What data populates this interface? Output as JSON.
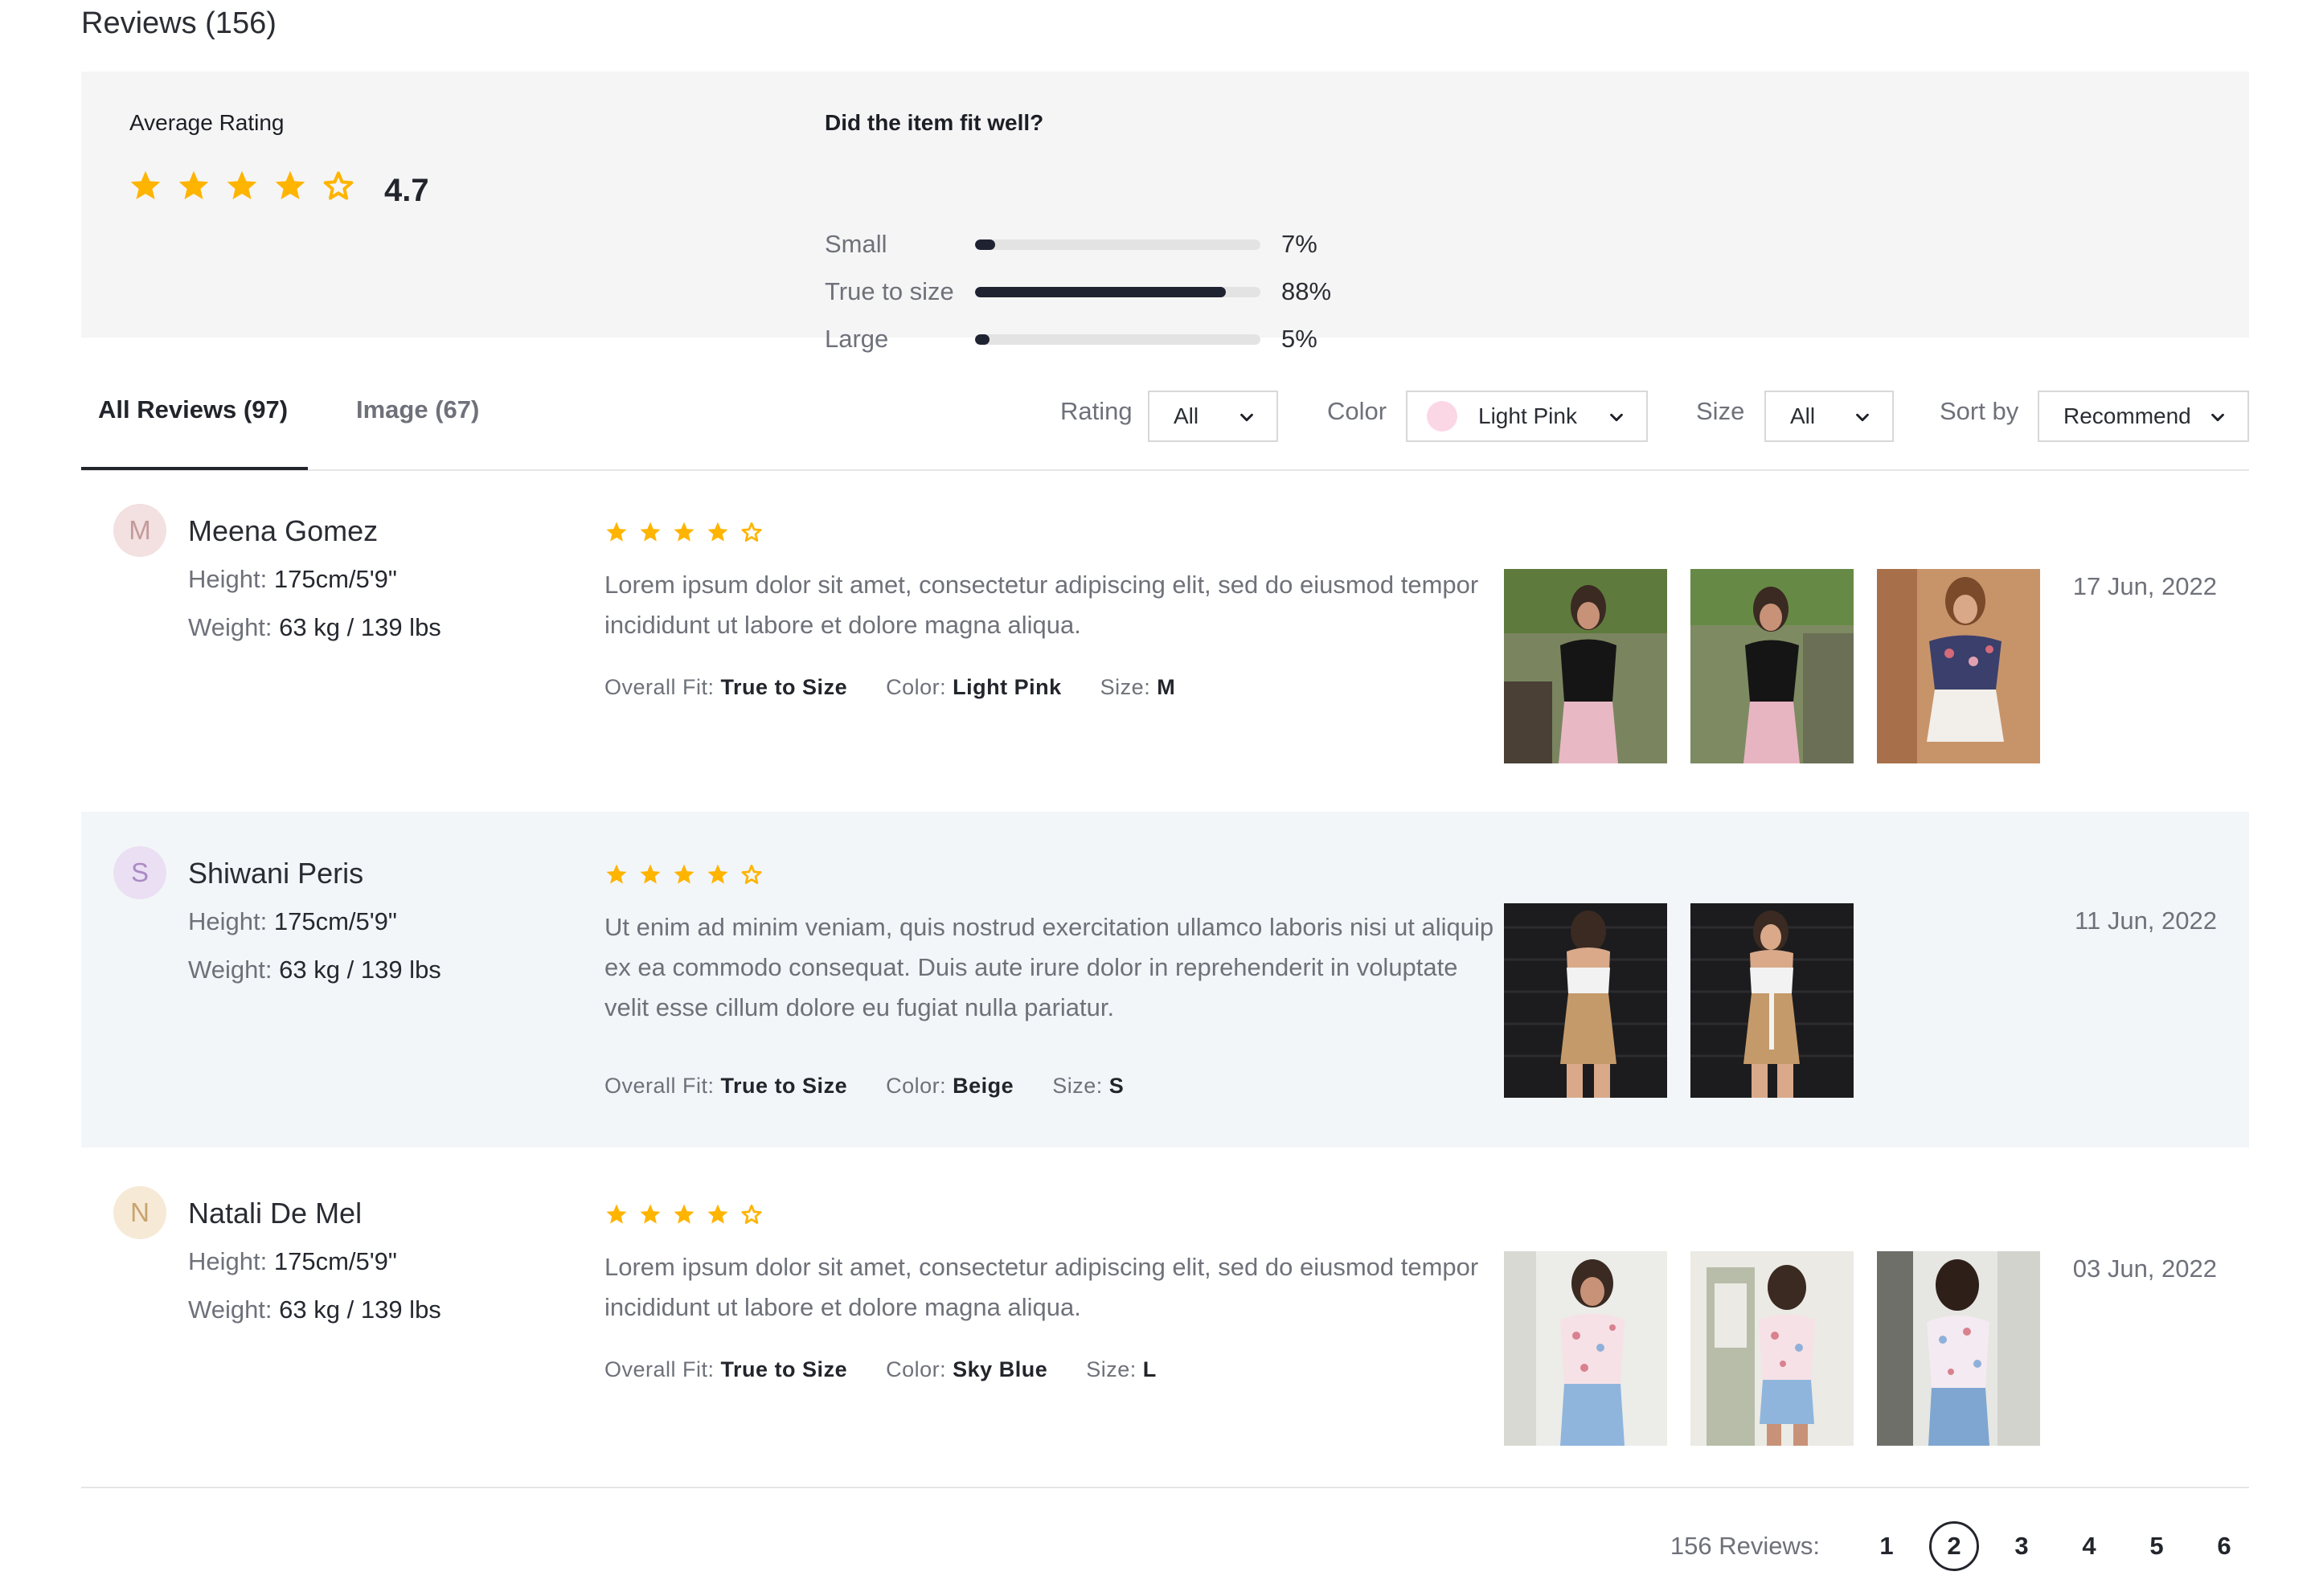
{
  "header": {
    "title": "Reviews (156)"
  },
  "summary": {
    "average_label": "Average Rating",
    "average_value": "4.7",
    "average_stars": 4,
    "fit_title": "Did the item fit well?",
    "fit": [
      {
        "label": "Small",
        "percent": 7,
        "percent_text": "7%"
      },
      {
        "label": "True to size",
        "percent": 88,
        "percent_text": "88%"
      },
      {
        "label": "Large",
        "percent": 5,
        "percent_text": "5%"
      }
    ]
  },
  "tabs": [
    {
      "label": "All Reviews (97)",
      "active": true
    },
    {
      "label": "Image (67)",
      "active": false
    }
  ],
  "filters": {
    "rating_label": "Rating",
    "rating_value": "All",
    "color_label": "Color",
    "color_value": "Light Pink",
    "color_swatch": "#fbd7e6",
    "size_label": "Size",
    "size_value": "All",
    "sort_label": "Sort by",
    "sort_value": "Recommend"
  },
  "labels": {
    "height": "Height:",
    "weight": "Weight:",
    "overall_fit": "Overall Fit:",
    "color": "Color:",
    "size": "Size:"
  },
  "reviews": [
    {
      "initial": "M",
      "avatar_bg": "#f3e0e0",
      "avatar_fg": "#c49a9a",
      "name": "Meena Gomez",
      "height": "175cm/5'9\"",
      "weight": "63 kg / 139 lbs",
      "stars": 4,
      "text": "Lorem ipsum dolor sit amet, consectetur adipiscing elit, sed do eiusmod tempor incididunt ut labore et dolore magna aliqua.",
      "fit": "True to Size",
      "color": "Light Pink",
      "size": "M",
      "date": "17 Jun, 2022",
      "photos": [
        "photo-black-top-pink-shorts",
        "photo-black-top-pink-shorts-side",
        "photo-floral-top-white-shorts"
      ]
    },
    {
      "initial": "S",
      "avatar_bg": "#eadff3",
      "avatar_fg": "#ab8ac4",
      "name": "Shiwani Peris",
      "height": "175cm/5'9\"",
      "weight": "63 kg / 139 lbs",
      "stars": 4,
      "text": "Ut enim ad minim veniam, quis nostrud exercitation ullamco laboris nisi ut aliquip ex ea commodo consequat. Duis aute irure dolor in reprehenderit in voluptate velit esse cillum dolore eu fugiat nulla pariatur.",
      "fit": "True to Size",
      "color": "Beige",
      "size": "S",
      "date": "11 Jun, 2022",
      "photos": [
        "photo-beige-shorts-back",
        "photo-beige-shorts-front"
      ]
    },
    {
      "initial": "N",
      "avatar_bg": "#f6e9d6",
      "avatar_fg": "#c9a46e",
      "name": "Natali De Mel",
      "height": "175cm/5'9\"",
      "weight": "63 kg / 139 lbs",
      "stars": 4,
      "text": "Lorem ipsum dolor sit amet, consectetur adipiscing elit, sed do eiusmod tempor incididunt ut labore et dolore magna aliqua.",
      "fit": "True to Size",
      "color": "Sky Blue",
      "size": "L",
      "date": "03 Jun, 2022",
      "photos": [
        "photo-floral-blouse-front",
        "photo-floral-blouse-side",
        "photo-floral-blouse-back"
      ]
    }
  ],
  "pagination": {
    "count_label": "156 Reviews:",
    "pages": [
      "1",
      "2",
      "3",
      "4",
      "5",
      "6"
    ],
    "current": "2"
  },
  "colors": {
    "star": "#ffb400",
    "text_dark": "#23252c",
    "text_muted": "#6f717a",
    "summary_bg": "#f5f5f5",
    "alt_row_bg": "#f3f6f8"
  }
}
